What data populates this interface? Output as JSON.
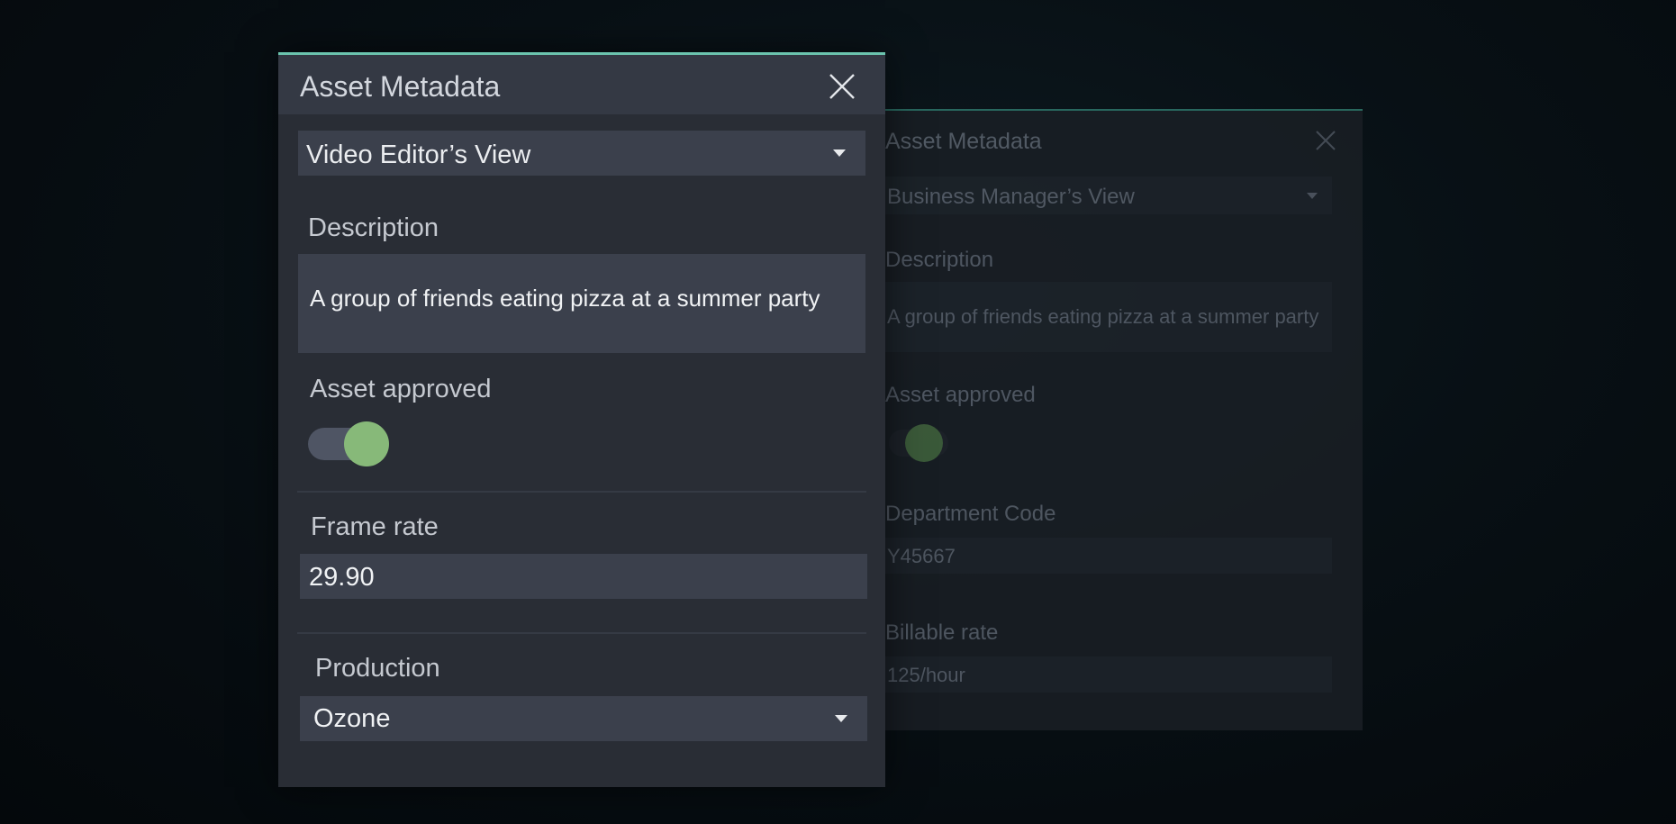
{
  "back_panel": {
    "title": "Asset Metadata",
    "view_select": {
      "selected": "Business Manager’s View"
    },
    "description": {
      "label": "Description",
      "value": "A group of friends eating pizza at a summer party"
    },
    "asset_approved": {
      "label": "Asset approved",
      "checked": true
    },
    "department_code": {
      "label": "Department Code",
      "value": "Y45667"
    },
    "billable_rate": {
      "label": "Billable rate",
      "value": "125/hour"
    }
  },
  "front_panel": {
    "title": "Asset Metadata",
    "view_select": {
      "selected": "Video Editor’s View"
    },
    "description": {
      "label": "Description",
      "value": "A group of friends eating pizza at a summer party"
    },
    "asset_approved": {
      "label": "Asset approved",
      "checked": true
    },
    "frame_rate": {
      "label": "Frame rate",
      "value": "29.90"
    },
    "production": {
      "label": "Production",
      "selected": "Ozone"
    }
  },
  "colors": {
    "accent": "#6bc4ae",
    "toggle_on": "#87b979",
    "panel_bg": "#292d35",
    "field_bg": "#3b404c"
  },
  "icons": {
    "close": "close-icon",
    "dropdown": "chevron-down-icon"
  }
}
